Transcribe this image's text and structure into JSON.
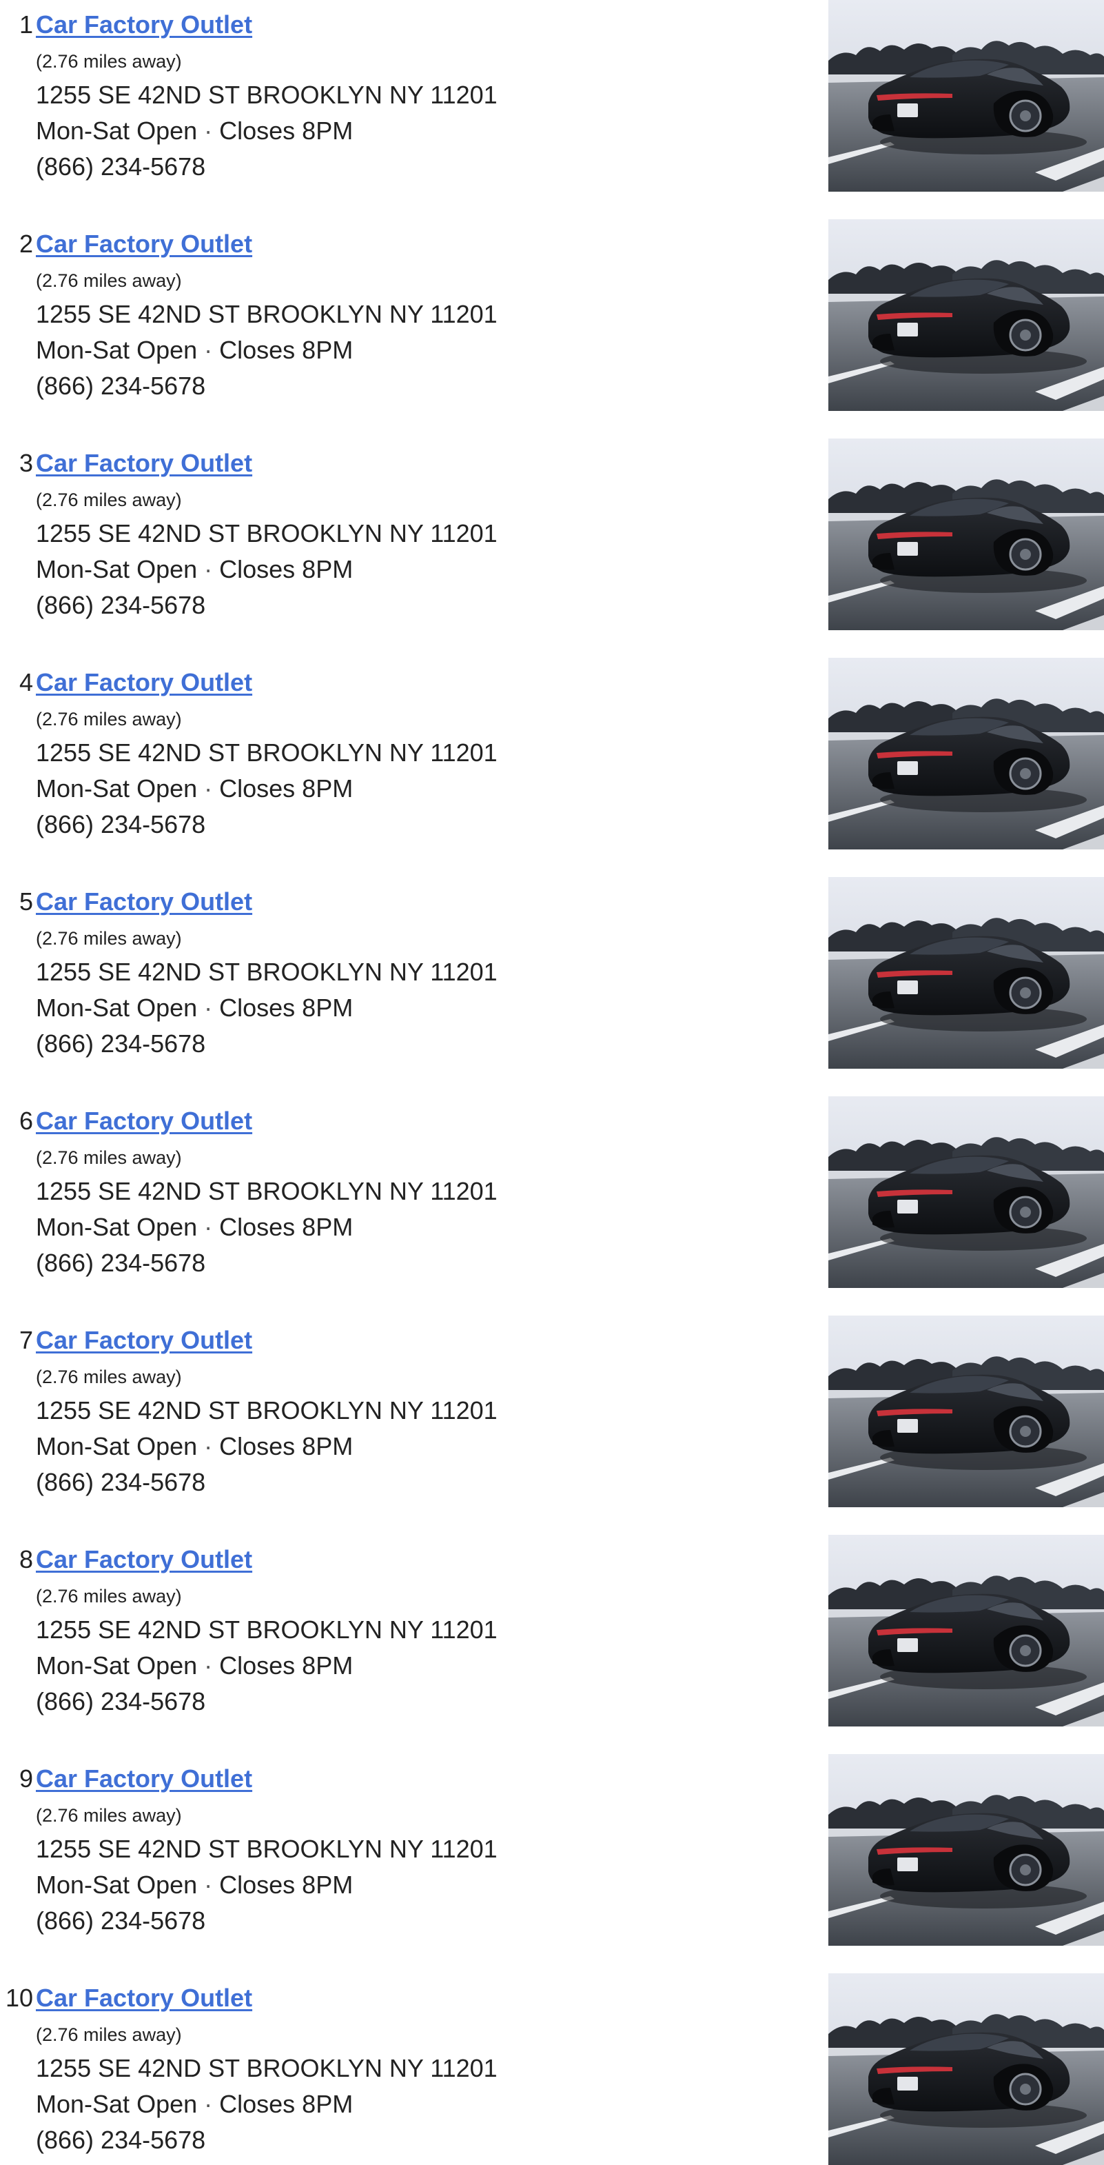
{
  "results": [
    {
      "index": "1",
      "name": "Car Factory Outlet",
      "distance": "(2.76 miles away)",
      "address": "1255 SE 42ND ST BROOKLYN NY 11201",
      "days": "Mon-Sat",
      "status": "Open",
      "closes": "Closes 8PM",
      "phone": "(866) 234-5678",
      "image": "car-photo"
    },
    {
      "index": "2",
      "name": "Car Factory Outlet",
      "distance": "(2.76 miles away)",
      "address": "1255 SE 42ND ST BROOKLYN NY 11201",
      "days": "Mon-Sat",
      "status": "Open",
      "closes": "Closes 8PM",
      "phone": "(866) 234-5678",
      "image": "car-photo"
    },
    {
      "index": "3",
      "name": "Car Factory Outlet",
      "distance": "(2.76 miles away)",
      "address": "1255 SE 42ND ST BROOKLYN NY 11201",
      "days": "Mon-Sat",
      "status": "Open",
      "closes": "Closes 8PM",
      "phone": "(866) 234-5678",
      "image": "car-photo"
    },
    {
      "index": "4",
      "name": "Car Factory Outlet",
      "distance": "(2.76 miles away)",
      "address": "1255 SE 42ND ST BROOKLYN NY 11201",
      "days": "Mon-Sat",
      "status": "Open",
      "closes": "Closes 8PM",
      "phone": "(866) 234-5678",
      "image": "car-photo"
    },
    {
      "index": "5",
      "name": "Car Factory Outlet",
      "distance": "(2.76 miles away)",
      "address": "1255 SE 42ND ST BROOKLYN NY 11201",
      "days": "Mon-Sat",
      "status": "Open",
      "closes": "Closes 8PM",
      "phone": "(866) 234-5678",
      "image": "car-photo"
    },
    {
      "index": "6",
      "name": "Car Factory Outlet",
      "distance": "(2.76 miles away)",
      "address": "1255 SE 42ND ST BROOKLYN NY 11201",
      "days": "Mon-Sat",
      "status": "Open",
      "closes": "Closes 8PM",
      "phone": "(866) 234-5678",
      "image": "car-photo"
    },
    {
      "index": "7",
      "name": "Car Factory Outlet",
      "distance": "(2.76 miles away)",
      "address": "1255 SE 42ND ST BROOKLYN NY 11201",
      "days": "Mon-Sat",
      "status": "Open",
      "closes": "Closes 8PM",
      "phone": "(866) 234-5678",
      "image": "car-photo"
    },
    {
      "index": "8",
      "name": "Car Factory Outlet",
      "distance": "(2.76 miles away)",
      "address": "1255 SE 42ND ST BROOKLYN NY 11201",
      "days": "Mon-Sat",
      "status": "Open",
      "closes": "Closes 8PM",
      "phone": "(866) 234-5678",
      "image": "car-photo"
    },
    {
      "index": "9",
      "name": "Car Factory Outlet",
      "distance": "(2.76 miles away)",
      "address": "1255 SE 42ND ST BROOKLYN NY 11201",
      "days": "Mon-Sat",
      "status": "Open",
      "closes": "Closes 8PM",
      "phone": "(866) 234-5678",
      "image": "car-photo"
    },
    {
      "index": "10",
      "name": "Car Factory Outlet",
      "distance": "(2.76 miles away)",
      "address": "1255 SE 42ND ST BROOKLYN NY 11201",
      "days": "Mon-Sat",
      "status": "Open",
      "closes": "Closes 8PM",
      "phone": "(866) 234-5678",
      "image": "car-photo"
    }
  ],
  "colors": {
    "link": "#3f6fd6",
    "text": "#222222",
    "background": "#ffffff"
  }
}
